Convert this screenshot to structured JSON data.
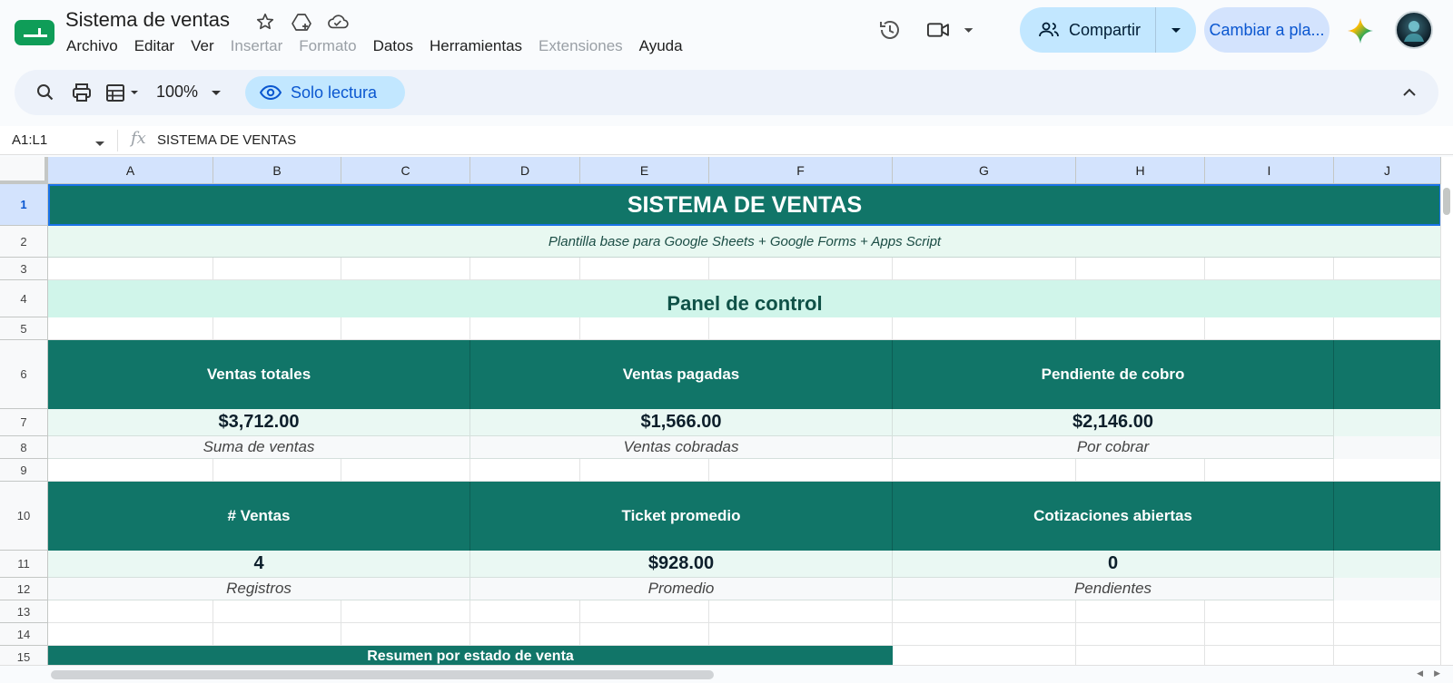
{
  "app": {
    "title": "Sistema de ventas",
    "brand_color": "#0f9d58",
    "accent_color": "#0b57d0"
  },
  "title_icons": [
    "star-icon",
    "move-to-drive-icon",
    "cloud-status-icon"
  ],
  "menu": [
    {
      "label": "Archivo",
      "enabled": true
    },
    {
      "label": "Editar",
      "enabled": true
    },
    {
      "label": "Ver",
      "enabled": true
    },
    {
      "label": "Insertar",
      "enabled": false
    },
    {
      "label": "Formato",
      "enabled": false
    },
    {
      "label": "Datos",
      "enabled": true
    },
    {
      "label": "Herramientas",
      "enabled": true
    },
    {
      "label": "Extensiones",
      "enabled": false
    },
    {
      "label": "Ayuda",
      "enabled": true
    }
  ],
  "header_actions": {
    "share_label": "Compartir",
    "switch_label": "Cambiar a pla..."
  },
  "toolbar": {
    "zoom": "100%",
    "mode_label": "Solo lectura"
  },
  "formula_bar": {
    "name_box": "A1:L1",
    "fx_label": "fx",
    "content": "SISTEMA DE VENTAS"
  },
  "grid": {
    "columns": [
      "A",
      "B",
      "C",
      "D",
      "E",
      "F",
      "G",
      "H",
      "I",
      "J"
    ],
    "rows": [
      "1",
      "2",
      "3",
      "4",
      "5",
      "6",
      "7",
      "8",
      "9",
      "10",
      "11",
      "12",
      "13",
      "14",
      "15"
    ],
    "selected_row": "1"
  },
  "sheet": {
    "title": "SISTEMA DE VENTAS",
    "subtitle": "Plantilla base para Google Sheets + Google Forms + Apps Script",
    "panel_title": "Panel de control",
    "kpis_row1": [
      {
        "heading": "Ventas totales",
        "value": "$3,712.00",
        "caption": "Suma de ventas"
      },
      {
        "heading": "Ventas pagadas",
        "value": "$1,566.00",
        "caption": "Ventas cobradas"
      },
      {
        "heading": "Pendiente de cobro",
        "value": "$2,146.00",
        "caption": "Por cobrar"
      }
    ],
    "kpis_row2": [
      {
        "heading": "# Ventas",
        "value": "4",
        "caption": "Registros"
      },
      {
        "heading": "Ticket promedio",
        "value": "$928.00",
        "caption": "Promedio"
      },
      {
        "heading": "Cotizaciones abiertas",
        "value": "0",
        "caption": "Pendientes"
      }
    ],
    "summary_title": "Resumen por estado de venta",
    "header_color": "#117568"
  }
}
